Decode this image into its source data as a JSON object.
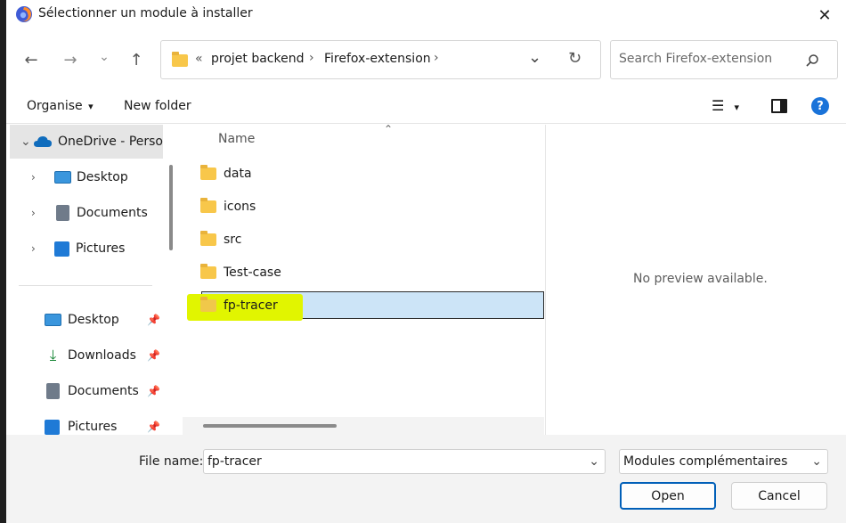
{
  "dialog": {
    "title": "Sélectionner un module à installer",
    "close_glyph": "✕"
  },
  "nav": {
    "back_glyph": "←",
    "forward_glyph": "→",
    "recent_glyph": "⌄",
    "up_glyph": "↑"
  },
  "address": {
    "overflow_glyph": "«",
    "crumbs": [
      "projet backend",
      "Firefox-extension"
    ],
    "sep_glyph": "›",
    "dropdown_glyph": "⌄",
    "refresh_glyph": "↻"
  },
  "search": {
    "placeholder": "Search Firefox-extension",
    "icon": "search-icon"
  },
  "toolbar": {
    "organise_label": "Organise",
    "organise_caret": "▾",
    "new_folder_label": "New folder",
    "view_glyph": "☰",
    "view_caret": "▾",
    "help_glyph": "?"
  },
  "sidebar": {
    "onedrive": {
      "label": "OneDrive - Perso",
      "expand": "⌄"
    },
    "items": [
      {
        "label": "Desktop",
        "expand": "›"
      },
      {
        "label": "Documents",
        "expand": "›"
      },
      {
        "label": "Pictures",
        "expand": "›"
      }
    ],
    "quick_access": [
      {
        "label": "Desktop",
        "pin": "📌"
      },
      {
        "label": "Downloads",
        "pin": "📌"
      },
      {
        "label": "Documents",
        "pin": "📌"
      },
      {
        "label": "Pictures",
        "pin": "📌"
      }
    ]
  },
  "file_list": {
    "column_name": "Name",
    "sort_glyph": "⌃",
    "items": [
      {
        "name": "data"
      },
      {
        "name": "icons"
      },
      {
        "name": "src"
      },
      {
        "name": "Test-case"
      },
      {
        "name": "fp-tracer"
      }
    ],
    "selected": "fp-tracer"
  },
  "preview": {
    "message": "No preview available."
  },
  "footer": {
    "file_name_label": "File name:",
    "file_name_value": "fp-tracer",
    "file_type_value": "Modules complémentaires",
    "caret_glyph": "⌄",
    "open_label": "Open",
    "cancel_label": "Cancel"
  },
  "colors": {
    "accent": "#005fb8",
    "selection": "#cce4f7",
    "highlight": "#e1f500",
    "folder": "#f8c74a"
  }
}
